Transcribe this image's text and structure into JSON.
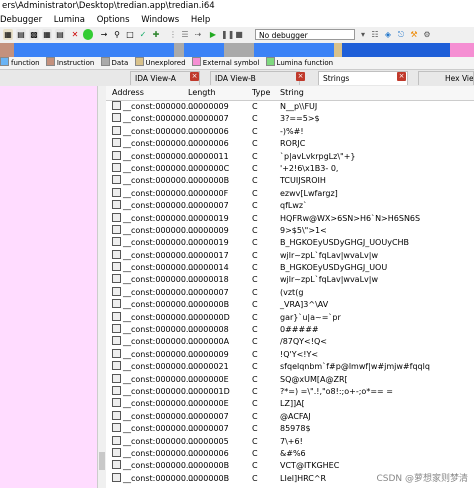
{
  "window": {
    "title": "ers\\Administrator\\Desktop\\tredian.app\\tredian.i64"
  },
  "menu": [
    "Debugger",
    "Lumina",
    "Options",
    "Windows",
    "Help"
  ],
  "toolbar": {
    "debugger_select": "No debugger"
  },
  "legend": [
    {
      "label": "function",
      "color": "#6ab4f5"
    },
    {
      "label": "Instruction",
      "color": "#c4917d"
    },
    {
      "label": "Data",
      "color": "#aaaaaa"
    },
    {
      "label": "Unexplored",
      "color": "#d9c28b"
    },
    {
      "label": "External symbol",
      "color": "#f58fd3"
    },
    {
      "label": "Lumina function",
      "color": "#7fd97f"
    }
  ],
  "tabs": [
    {
      "label": "IDA View-A"
    },
    {
      "label": "IDA View-B"
    },
    {
      "label": "Strings"
    },
    {
      "label": "Hex View"
    }
  ],
  "table": {
    "columns": [
      "Address",
      "Length",
      "Type",
      "String"
    ],
    "rows": [
      {
        "address": "__const:000000...",
        "length": "00000009",
        "type": "C",
        "string": "N__p\\\\FUJ"
      },
      {
        "address": "__const:000000...",
        "length": "00000007",
        "type": "C",
        "string": "3?==5>$"
      },
      {
        "address": "__const:000000...",
        "length": "00000006",
        "type": "C",
        "string": "-)%#!"
      },
      {
        "address": "__const:000000...",
        "length": "00000006",
        "type": "C",
        "string": "RORJC"
      },
      {
        "address": "__const:000000...",
        "length": "00000011",
        "type": "C",
        "string": "`p|avLvkrpgLz\\\"+}"
      },
      {
        "address": "__const:000000...",
        "length": "0000000C",
        "type": "C",
        "string": "'+2!6\\x1B3- 0,"
      },
      {
        "address": "__const:000000...",
        "length": "0000000B",
        "type": "C",
        "string": "TCUIJSROIH"
      },
      {
        "address": "__const:000000...",
        "length": "0000000F",
        "type": "C",
        "string": "ezwv[Lwfargz]"
      },
      {
        "address": "__const:000000...",
        "length": "00000007",
        "type": "C",
        "string": "qfLwz`"
      },
      {
        "address": "__const:000000...",
        "length": "00000019",
        "type": "C",
        "string": "HQFRw@WX>6SN>H6`N>H6SN6S"
      },
      {
        "address": "__const:000000...",
        "length": "00000009",
        "type": "C",
        "string": "9>$5\\\">1<"
      },
      {
        "address": "__const:000000...",
        "length": "00000019",
        "type": "C",
        "string": "B_HGKOEyUSDyGHGJ_UOUyCHB"
      },
      {
        "address": "__const:000000...",
        "length": "00000017",
        "type": "C",
        "string": "wjlr~zpL`fqLav|wvaLv|w"
      },
      {
        "address": "__const:000000...",
        "length": "00000014",
        "type": "C",
        "string": "B_HGKOEyUSDyGHGJ_UOU"
      },
      {
        "address": "__const:000000...",
        "length": "00000018",
        "type": "C",
        "string": "wjlr~zpL`fqLav|wvaLv|w"
      },
      {
        "address": "__const:000000...",
        "length": "00000007",
        "type": "C",
        "string": "(vzt(g"
      },
      {
        "address": "__const:000000...",
        "length": "0000000B",
        "type": "C",
        "string": "_VRA]3^\\AV"
      },
      {
        "address": "__const:000000...",
        "length": "0000000D",
        "type": "C",
        "string": "gar}`u|a~=`pr"
      },
      {
        "address": "__const:000000...",
        "length": "00000008",
        "type": "C",
        "string": "0#####"
      },
      {
        "address": "__const:000000...",
        "length": "0000000A",
        "type": "C",
        "string": "/87QY<!Q<"
      },
      {
        "address": "__const:000000...",
        "length": "00000009",
        "type": "C",
        "string": "!Q'Y<!Y<"
      },
      {
        "address": "__const:000000...",
        "length": "00000021",
        "type": "C",
        "string": "sfqelqnbm`f#p@lmwf|w#jmjw#fqqlq"
      },
      {
        "address": "__const:000000...",
        "length": "0000000E",
        "type": "C",
        "string": "SQ@xUM[A@ZR["
      },
      {
        "address": "__const:000000...",
        "length": "0000001D",
        "type": "C",
        "string": "?*=) =\\\".!,\"o8!:;o+-;o*== ="
      },
      {
        "address": "__const:000000...",
        "length": "0000000E",
        "type": "C",
        "string": "LZ]]A["
      },
      {
        "address": "__const:000000...",
        "length": "00000007",
        "type": "C",
        "string": "@ACFAJ"
      },
      {
        "address": "__const:000000...",
        "length": "00000007",
        "type": "C",
        "string": "85978$"
      },
      {
        "address": "__const:000000...",
        "length": "00000005",
        "type": "C",
        "string": "7\\+6!"
      },
      {
        "address": "__const:000000...",
        "length": "00000006",
        "type": "C",
        "string": "&#%6"
      },
      {
        "address": "__const:000000...",
        "length": "0000000B",
        "type": "C",
        "string": "VCT@ITKGHEC"
      },
      {
        "address": "__const:000000...",
        "length": "0000000B",
        "type": "C",
        "string": "LIel]HRC^R"
      }
    ]
  },
  "watermark": "CSDN @萝想家则梦清"
}
